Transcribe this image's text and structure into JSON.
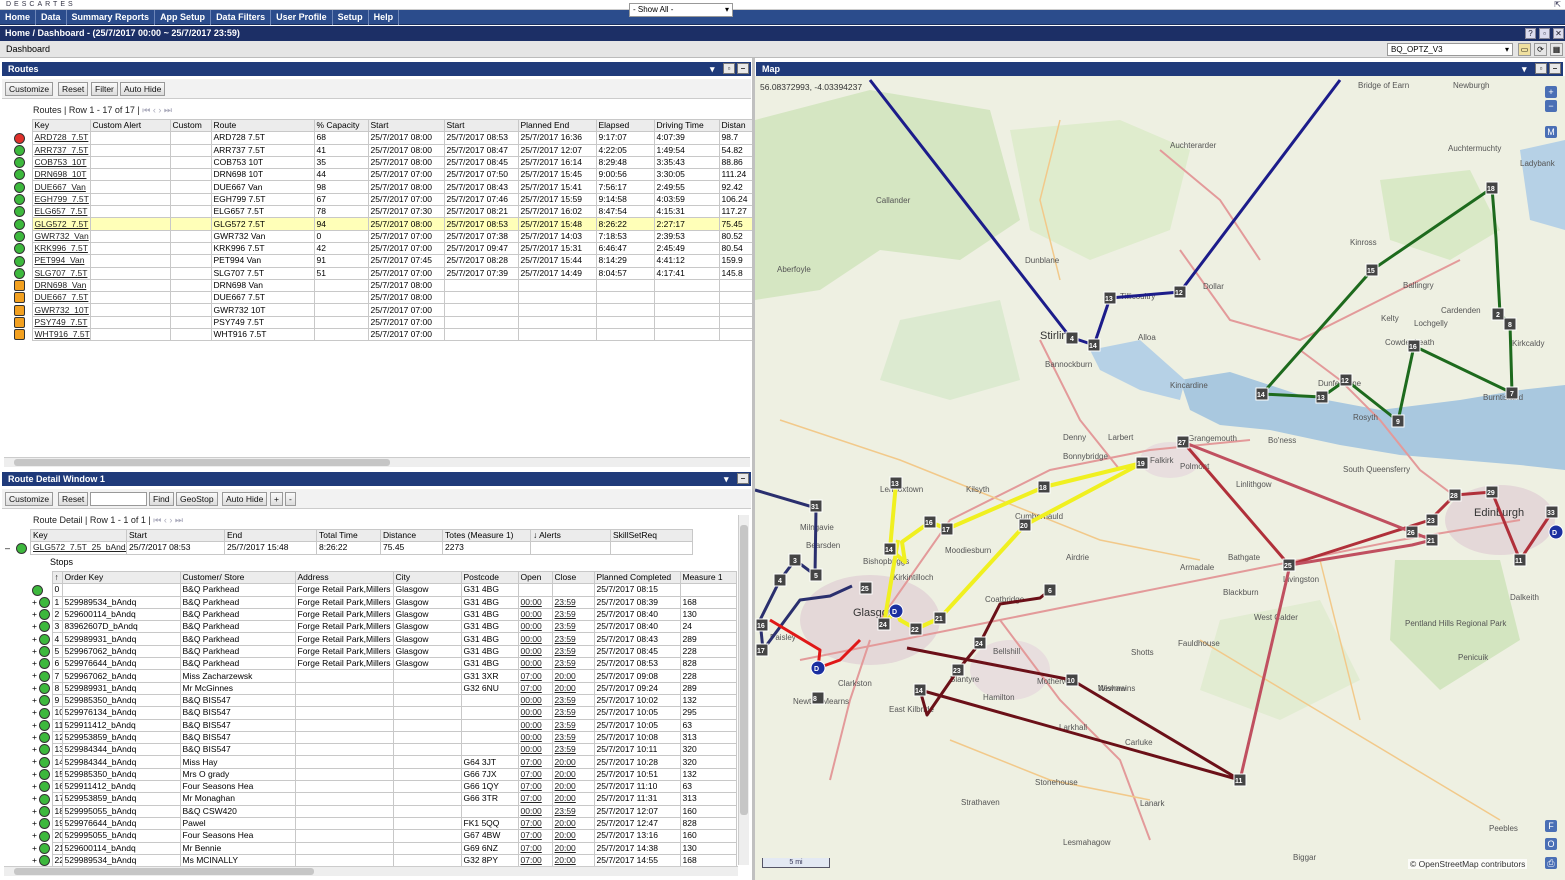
{
  "app": {
    "brand": "DESCARTES",
    "signout": "⇱"
  },
  "menu": [
    "Home",
    "Data",
    "Summary Reports",
    "App Setup",
    "Data Filters",
    "User Profile",
    "Setup",
    "Help"
  ],
  "breadcrumb": "Home / Dashboard - (25/7/2017 00:00 ~ 25/7/2017 23:59)",
  "dashboard": {
    "title": "Dashboard",
    "profile": "BQ_OPTZ_V3"
  },
  "routes_panel": {
    "title": "Routes",
    "buttons": [
      "Customize",
      "Reset",
      "Filter",
      "Auto Hide"
    ],
    "filter_select": "- Show All -",
    "pager": "Routes | Row 1 - 17 of 17 |",
    "columns": [
      "Key",
      "Custom Alert",
      "Custom",
      "Route",
      "% Capacity",
      "Start",
      "Start",
      "Planned End",
      "Elapsed",
      "Driving Time",
      "Distan"
    ],
    "rows": [
      {
        "status": "bad",
        "key": "ARD728_7.5T",
        "route": "ARD728 7.5T",
        "cap": "68",
        "start1": "25/7/2017 08:00",
        "start2": "25/7/2017 08:53",
        "end": "25/7/2017 16:36",
        "elapsed": "9:17:07",
        "drive": "4:07:39",
        "dist": "98.7"
      },
      {
        "status": "ok",
        "key": "ARR737_7.5T",
        "route": "ARR737 7.5T",
        "cap": "41",
        "start1": "25/7/2017 08:00",
        "start2": "25/7/2017 08:47",
        "end": "25/7/2017 12:07",
        "elapsed": "4:22:05",
        "drive": "1:49:54",
        "dist": "54.82"
      },
      {
        "status": "ok",
        "key": "COB753_10T",
        "route": "COB753 10T",
        "cap": "35",
        "start1": "25/7/2017 08:00",
        "start2": "25/7/2017 08:45",
        "end": "25/7/2017 16:14",
        "elapsed": "8:29:48",
        "drive": "3:35:43",
        "dist": "88.86"
      },
      {
        "status": "ok",
        "key": "DRN698_10T",
        "route": "DRN698 10T",
        "cap": "44",
        "start1": "25/7/2017 07:00",
        "start2": "25/7/2017 07:50",
        "end": "25/7/2017 15:45",
        "elapsed": "9:00:56",
        "drive": "3:30:05",
        "dist": "111.24"
      },
      {
        "status": "ok",
        "key": "DUE667_Van",
        "route": "DUE667 Van",
        "cap": "98",
        "start1": "25/7/2017 08:00",
        "start2": "25/7/2017 08:43",
        "end": "25/7/2017 15:41",
        "elapsed": "7:56:17",
        "drive": "2:49:55",
        "dist": "92.42"
      },
      {
        "status": "ok",
        "key": "EGH799_7.5T",
        "route": "EGH799 7.5T",
        "cap": "67",
        "start1": "25/7/2017 07:00",
        "start2": "25/7/2017 07:46",
        "end": "25/7/2017 15:59",
        "elapsed": "9:14:58",
        "drive": "4:03:59",
        "dist": "106.24"
      },
      {
        "status": "ok",
        "key": "ELG657_7.5T",
        "route": "ELG657 7.5T",
        "cap": "78",
        "start1": "25/7/2017 07:30",
        "start2": "25/7/2017 08:21",
        "end": "25/7/2017 16:02",
        "elapsed": "8:47:54",
        "drive": "4:15:31",
        "dist": "117.27"
      },
      {
        "status": "ok",
        "key": "GLG572_7.5T",
        "route": "GLG572 7.5T",
        "cap": "94",
        "start1": "25/7/2017 08:00",
        "start2": "25/7/2017 08:53",
        "end": "25/7/2017 15:48",
        "elapsed": "8:26:22",
        "drive": "2:27:17",
        "dist": "75.45",
        "hl": true
      },
      {
        "status": "ok",
        "key": "GWR732_Van",
        "route": "GWR732 Van",
        "cap": "0",
        "start1": "25/7/2017 07:00",
        "start2": "25/7/2017 07:38",
        "end": "25/7/2017 14:03",
        "elapsed": "7:18:53",
        "drive": "2:39:53",
        "dist": "80.52"
      },
      {
        "status": "ok",
        "key": "KRK996_7.5T",
        "route": "KRK996 7.5T",
        "cap": "42",
        "start1": "25/7/2017 07:00",
        "start2": "25/7/2017 09:47",
        "end": "25/7/2017 15:31",
        "elapsed": "6:46:47",
        "drive": "2:45:49",
        "dist": "80.54"
      },
      {
        "status": "ok",
        "key": "PET994_Van",
        "route": "PET994 Van",
        "cap": "91",
        "start1": "25/7/2017 07:45",
        "start2": "25/7/2017 08:28",
        "end": "25/7/2017 15:44",
        "elapsed": "8:14:29",
        "drive": "4:41:12",
        "dist": "159.9"
      },
      {
        "status": "ok",
        "key": "SLG707_7.5T",
        "route": "SLG707 7.5T",
        "cap": "51",
        "start1": "25/7/2017 07:00",
        "start2": "25/7/2017 07:39",
        "end": "25/7/2017 14:49",
        "elapsed": "8:04:57",
        "drive": "4:17:41",
        "dist": "145.8"
      },
      {
        "status": "warn",
        "key": "DRN698_Van",
        "route": "DRN698 Van",
        "cap": "",
        "start1": "25/7/2017 08:00",
        "start2": "",
        "end": "",
        "elapsed": "",
        "drive": "",
        "dist": ""
      },
      {
        "status": "warn",
        "key": "DUE667_7.5T",
        "route": "DUE667 7.5T",
        "cap": "",
        "start1": "25/7/2017 08:00",
        "start2": "",
        "end": "",
        "elapsed": "",
        "drive": "",
        "dist": ""
      },
      {
        "status": "warn",
        "key": "GWR732_10T",
        "route": "GWR732 10T",
        "cap": "",
        "start1": "25/7/2017 07:00",
        "start2": "",
        "end": "",
        "elapsed": "",
        "drive": "",
        "dist": ""
      },
      {
        "status": "warn",
        "key": "PSY749_7.5T",
        "route": "PSY749 7.5T",
        "cap": "",
        "start1": "25/7/2017 07:00",
        "start2": "",
        "end": "",
        "elapsed": "",
        "drive": "",
        "dist": ""
      },
      {
        "status": "warn",
        "key": "WHT916_7.5T",
        "route": "WHT916 7.5T",
        "cap": "",
        "start1": "25/7/2017 07:00",
        "start2": "",
        "end": "",
        "elapsed": "",
        "drive": "",
        "dist": ""
      }
    ]
  },
  "detail_panel": {
    "title": "Route Detail Window 1",
    "buttons": [
      "Customize",
      "Reset",
      "Find",
      "GeoStop",
      "Auto Hide",
      "+",
      "-"
    ],
    "pager": "Route Detail | Row 1 - 1 of 1 |",
    "columns": [
      "Key",
      "Start",
      "End",
      "Total Time",
      "Distance",
      "Totes (Measure 1)",
      "↓ Alerts",
      "SkillSetReq"
    ],
    "row": {
      "key": "GLG572_7.5T_25_bAndq",
      "start": "25/7/2017 08:53",
      "end": "25/7/2017 15:48",
      "total": "8:26:22",
      "distance": "75.45",
      "totes": "2273",
      "alerts": "",
      "skill": ""
    },
    "stops_label": "Stops",
    "stop_columns": [
      "↑",
      "Order Key",
      "Customer/ Store",
      "Address",
      "City",
      "Postcode",
      "Open",
      "Close",
      "Planned Completed",
      "Measure 1"
    ],
    "stops": [
      {
        "n": "0",
        "order": "",
        "cust": "B&Q Parkhead",
        "addr": "Forge Retail Park,Millers",
        "city": "Glasgow",
        "pc": "G31 4BG",
        "open": "",
        "close": "",
        "planned": "25/7/2017 08:15",
        "m": ""
      },
      {
        "n": "1",
        "order": "529989534_bAndq",
        "cust": "B&Q Parkhead",
        "addr": "Forge Retail Park,Millers",
        "city": "Glasgow",
        "pc": "G31 4BG",
        "open": "00:00",
        "close": "23:59",
        "planned": "25/7/2017 08:39",
        "m": "168"
      },
      {
        "n": "2",
        "order": "529600114_bAndq",
        "cust": "B&Q Parkhead",
        "addr": "Forge Retail Park,Millers",
        "city": "Glasgow",
        "pc": "G31 4BG",
        "open": "00:00",
        "close": "23:59",
        "planned": "25/7/2017 08:40",
        "m": "130"
      },
      {
        "n": "3",
        "order": "83962607D_bAndq",
        "cust": "B&Q Parkhead",
        "addr": "Forge Retail Park,Millers",
        "city": "Glasgow",
        "pc": "G31 4BG",
        "open": "00:00",
        "close": "23:59",
        "planned": "25/7/2017 08:40",
        "m": "24"
      },
      {
        "n": "4",
        "order": "529989931_bAndq",
        "cust": "B&Q Parkhead",
        "addr": "Forge Retail Park,Millers",
        "city": "Glasgow",
        "pc": "G31 4BG",
        "open": "00:00",
        "close": "23:59",
        "planned": "25/7/2017 08:43",
        "m": "289"
      },
      {
        "n": "5",
        "order": "529967062_bAndq",
        "cust": "B&Q Parkhead",
        "addr": "Forge Retail Park,Millers",
        "city": "Glasgow",
        "pc": "G31 4BG",
        "open": "00:00",
        "close": "23:59",
        "planned": "25/7/2017 08:45",
        "m": "228"
      },
      {
        "n": "6",
        "order": "529976644_bAndq",
        "cust": "B&Q Parkhead",
        "addr": "Forge Retail Park,Millers",
        "city": "Glasgow",
        "pc": "G31 4BG",
        "open": "00:00",
        "close": "23:59",
        "planned": "25/7/2017 08:53",
        "m": "828"
      },
      {
        "n": "7",
        "order": "529967062_bAndq",
        "cust": "Miss Zacharzewsk",
        "addr": "",
        "city": "",
        "pc": "G31 3XR",
        "open": "07:00",
        "close": "20:00",
        "planned": "25/7/2017 09:08",
        "m": "228"
      },
      {
        "n": "8",
        "order": "529989931_bAndq",
        "cust": "Mr McGinnes",
        "addr": "",
        "city": "",
        "pc": "G32 6NU",
        "open": "07:00",
        "close": "20:00",
        "planned": "25/7/2017 09:24",
        "m": "289"
      },
      {
        "n": "9",
        "order": "529985350_bAndq",
        "cust": "B&Q BIS547",
        "addr": "",
        "city": "",
        "pc": "",
        "open": "00:00",
        "close": "23:59",
        "planned": "25/7/2017 10:02",
        "m": "132"
      },
      {
        "n": "10",
        "order": "529976134_bAndq",
        "cust": "B&Q BIS547",
        "addr": "",
        "city": "",
        "pc": "",
        "open": "00:00",
        "close": "23:59",
        "planned": "25/7/2017 10:05",
        "m": "295"
      },
      {
        "n": "11",
        "order": "529911412_bAndq",
        "cust": "B&Q BIS547",
        "addr": "",
        "city": "",
        "pc": "",
        "open": "00:00",
        "close": "23:59",
        "planned": "25/7/2017 10:05",
        "m": "63"
      },
      {
        "n": "12",
        "order": "529953859_bAndq",
        "cust": "B&Q BIS547",
        "addr": "",
        "city": "",
        "pc": "",
        "open": "00:00",
        "close": "23:59",
        "planned": "25/7/2017 10:08",
        "m": "313"
      },
      {
        "n": "13",
        "order": "529984344_bAndq",
        "cust": "B&Q BIS547",
        "addr": "",
        "city": "",
        "pc": "",
        "open": "00:00",
        "close": "23:59",
        "planned": "25/7/2017 10:11",
        "m": "320"
      },
      {
        "n": "14",
        "order": "529984344_bAndq",
        "cust": "Miss Hay",
        "addr": "",
        "city": "",
        "pc": "G64 3JT",
        "open": "07:00",
        "close": "20:00",
        "planned": "25/7/2017 10:28",
        "m": "320"
      },
      {
        "n": "15",
        "order": "529985350_bAndq",
        "cust": "Mrs O grady",
        "addr": "",
        "city": "",
        "pc": "G66 7JX",
        "open": "07:00",
        "close": "20:00",
        "planned": "25/7/2017 10:51",
        "m": "132"
      },
      {
        "n": "16",
        "order": "529911412_bAndq",
        "cust": "Four Seasons Hea",
        "addr": "",
        "city": "",
        "pc": "G66 1QY",
        "open": "07:00",
        "close": "20:00",
        "planned": "25/7/2017 11:10",
        "m": "63"
      },
      {
        "n": "17",
        "order": "529953859_bAndq",
        "cust": "Mr Monaghan",
        "addr": "",
        "city": "",
        "pc": "G66 3TR",
        "open": "07:00",
        "close": "20:00",
        "planned": "25/7/2017 11:31",
        "m": "313"
      },
      {
        "n": "18",
        "order": "529995055_bAndq",
        "cust": "B&Q CSW420",
        "addr": "",
        "city": "",
        "pc": "",
        "open": "00:00",
        "close": "23:59",
        "planned": "25/7/2017 12:07",
        "m": "160"
      },
      {
        "n": "19",
        "order": "529976644_bAndq",
        "cust": "Pawel",
        "addr": "",
        "city": "",
        "pc": "FK1 5QQ",
        "open": "07:00",
        "close": "20:00",
        "planned": "25/7/2017 12:47",
        "m": "828"
      },
      {
        "n": "20",
        "order": "529995055_bAndq",
        "cust": "Four Seasons Hea",
        "addr": "",
        "city": "",
        "pc": "G67 4BW",
        "open": "07:00",
        "close": "20:00",
        "planned": "25/7/2017 13:16",
        "m": "160"
      },
      {
        "n": "21",
        "order": "529600114_bAndq",
        "cust": "Mr Bennie",
        "addr": "",
        "city": "",
        "pc": "G69 6NZ",
        "open": "07:00",
        "close": "20:00",
        "planned": "25/7/2017 14:38",
        "m": "130"
      },
      {
        "n": "22",
        "order": "529989534_bAndq",
        "cust": "Ms MCINALLY",
        "addr": "",
        "city": "",
        "pc": "G32 8PY",
        "open": "07:00",
        "close": "20:00",
        "planned": "25/7/2017 14:55",
        "m": "168"
      }
    ]
  },
  "map_panel": {
    "title": "Map",
    "coords": "56.08372993, -4.03394237",
    "attribution": "© OpenStreetMap contributors",
    "scale": "5 mi",
    "places": [
      "Bridge of Earn",
      "Newburgh",
      "Auchtermuchty",
      "Ladybank",
      "Callander",
      "Auchterarder",
      "Dunblane",
      "Aberfoyle",
      "Dollar",
      "Kinross",
      "Ballingry",
      "Kelty",
      "Cardenden",
      "Lochgelly",
      "Kirkcaldy",
      "Cowdenbeath",
      "Burntisland",
      "Dunfermline",
      "Rosyth",
      "Stirling",
      "Alloa",
      "Tillicoultry",
      "Bannockburn",
      "Kincardine",
      "Denny",
      "Larbert",
      "Grangemouth",
      "Bo'ness",
      "Falkirk",
      "Bonnybridge",
      "Polmont",
      "Linlithgow",
      "South Queensferry",
      "Edinburgh",
      "Kilsyth",
      "Cumbernauld",
      "Moodiesburn",
      "Bishopbriggs",
      "Bearsden",
      "Glasgow",
      "Airdrie",
      "Armadale",
      "Livingston",
      "Bathgate",
      "Blackburn",
      "West Calder",
      "Coatbridge",
      "Bellshill",
      "Motherwell",
      "Shotts",
      "Wishaw",
      "Blantyre",
      "Hamilton",
      "East Kilbride",
      "Newton Mearns",
      "Clarkston",
      "Larkhall",
      "Fauldhouse",
      "Pentland Hills Regional Park",
      "Carluke",
      "Lanark",
      "Stonehouse",
      "Strathaven",
      "Lesmahagow",
      "Biggar",
      "Peebles",
      "Penicuik",
      "Dalkeith",
      "Newmains",
      "Kirkintilloch",
      "Lennoxtown",
      "Milngavie",
      "Paisley"
    ],
    "markers": {
      "blue": [
        "13",
        "12",
        "4",
        "14",
        "31",
        "5",
        "3",
        "4",
        "17",
        "16",
        "15",
        "7",
        "9",
        "5"
      ],
      "green": [
        "18",
        "15",
        "2",
        "8",
        "16",
        "14",
        "13",
        "12",
        "9",
        "7"
      ],
      "yellow": [
        "13",
        "19",
        "18",
        "16",
        "17",
        "20",
        "14",
        "25",
        "12",
        "21",
        "22",
        "24"
      ],
      "red": [
        "27",
        "28",
        "29",
        "23",
        "26",
        "22",
        "21",
        "25",
        "11",
        "33",
        "32",
        "8",
        "9",
        "6",
        "10",
        "14",
        "28",
        "29",
        "11",
        "24",
        "23"
      ],
      "depots": [
        "D",
        "D",
        "D"
      ]
    }
  }
}
